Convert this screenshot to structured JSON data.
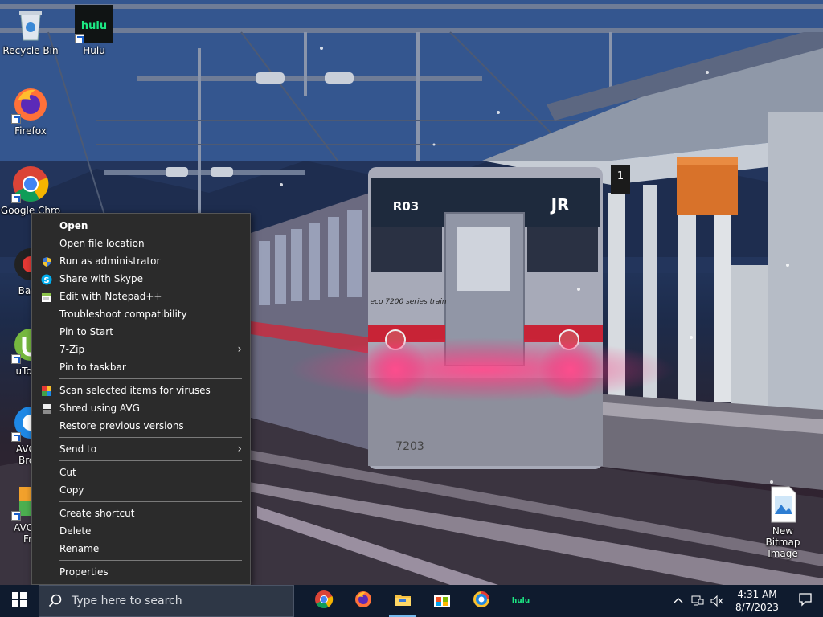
{
  "desktop": {
    "icons": [
      {
        "label": "Recycle Bin",
        "icon": "recycle-bin-icon"
      },
      {
        "label": "Hulu",
        "icon": "hulu-icon",
        "badge": "hulu"
      },
      {
        "label": "Firefox",
        "icon": "firefox-icon"
      },
      {
        "label": "Google Chro",
        "icon": "chrome-icon"
      },
      {
        "label": "Band",
        "icon": "bandicam-icon"
      },
      {
        "label": "uTorre",
        "icon": "utorrent-icon"
      },
      {
        "label": "AVG S Brow",
        "icon": "avg-browser-icon"
      },
      {
        "label": "AVG Ar Fre",
        "icon": "avg-antivirus-icon"
      },
      {
        "label": "New Bitmap Image",
        "icon": "bitmap-file-icon"
      }
    ],
    "wallpaper": {
      "train_number": "R03",
      "train_brand": "JR",
      "train_series": "eco 7200 series train",
      "car_number": "7203",
      "platform_sign": "1"
    }
  },
  "context_menu": {
    "items": [
      {
        "label": "Open",
        "bold": true
      },
      {
        "label": "Open file location"
      },
      {
        "label": "Run as administrator",
        "icon": "shield-icon"
      },
      {
        "label": "Share with Skype",
        "icon": "skype-icon"
      },
      {
        "label": "Edit with Notepad++",
        "icon": "notepadpp-icon"
      },
      {
        "label": "Troubleshoot compatibility"
      },
      {
        "label": "Pin to Start"
      },
      {
        "label": "7-Zip",
        "submenu": true
      },
      {
        "label": "Pin to taskbar"
      },
      {
        "label": "Scan selected items for viruses",
        "icon": "avg-scan-icon"
      },
      {
        "label": "Shred using AVG",
        "icon": "avg-shred-icon"
      },
      {
        "label": "Restore previous versions"
      },
      {
        "label": "Send to",
        "submenu": true
      },
      {
        "label": "Cut"
      },
      {
        "label": "Copy"
      },
      {
        "label": "Create shortcut"
      },
      {
        "label": "Delete"
      },
      {
        "label": "Rename"
      },
      {
        "label": "Properties"
      }
    ]
  },
  "taskbar": {
    "search_placeholder": "Type here to search",
    "apps": [
      {
        "name": "chrome",
        "icon": "chrome-icon"
      },
      {
        "name": "firefox",
        "icon": "firefox-icon"
      },
      {
        "name": "file-explorer",
        "icon": "folder-icon",
        "active": true
      },
      {
        "name": "microsoft-store",
        "icon": "store-icon"
      },
      {
        "name": "avg-browser",
        "icon": "avg-browser-icon"
      },
      {
        "name": "hulu",
        "icon": "hulu-icon",
        "badge": "hulu"
      }
    ],
    "clock": {
      "time": "4:31 AM",
      "date": "8/7/2023"
    }
  },
  "colors": {
    "menu_bg": "#2b2b2b",
    "taskbar_bg": "#0f1b2e",
    "hulu_green": "#1ce783",
    "chrome_red": "#db4437",
    "chrome_yellow": "#f4b400",
    "chrome_green": "#0f9d58",
    "chrome_blue": "#4285f4"
  }
}
